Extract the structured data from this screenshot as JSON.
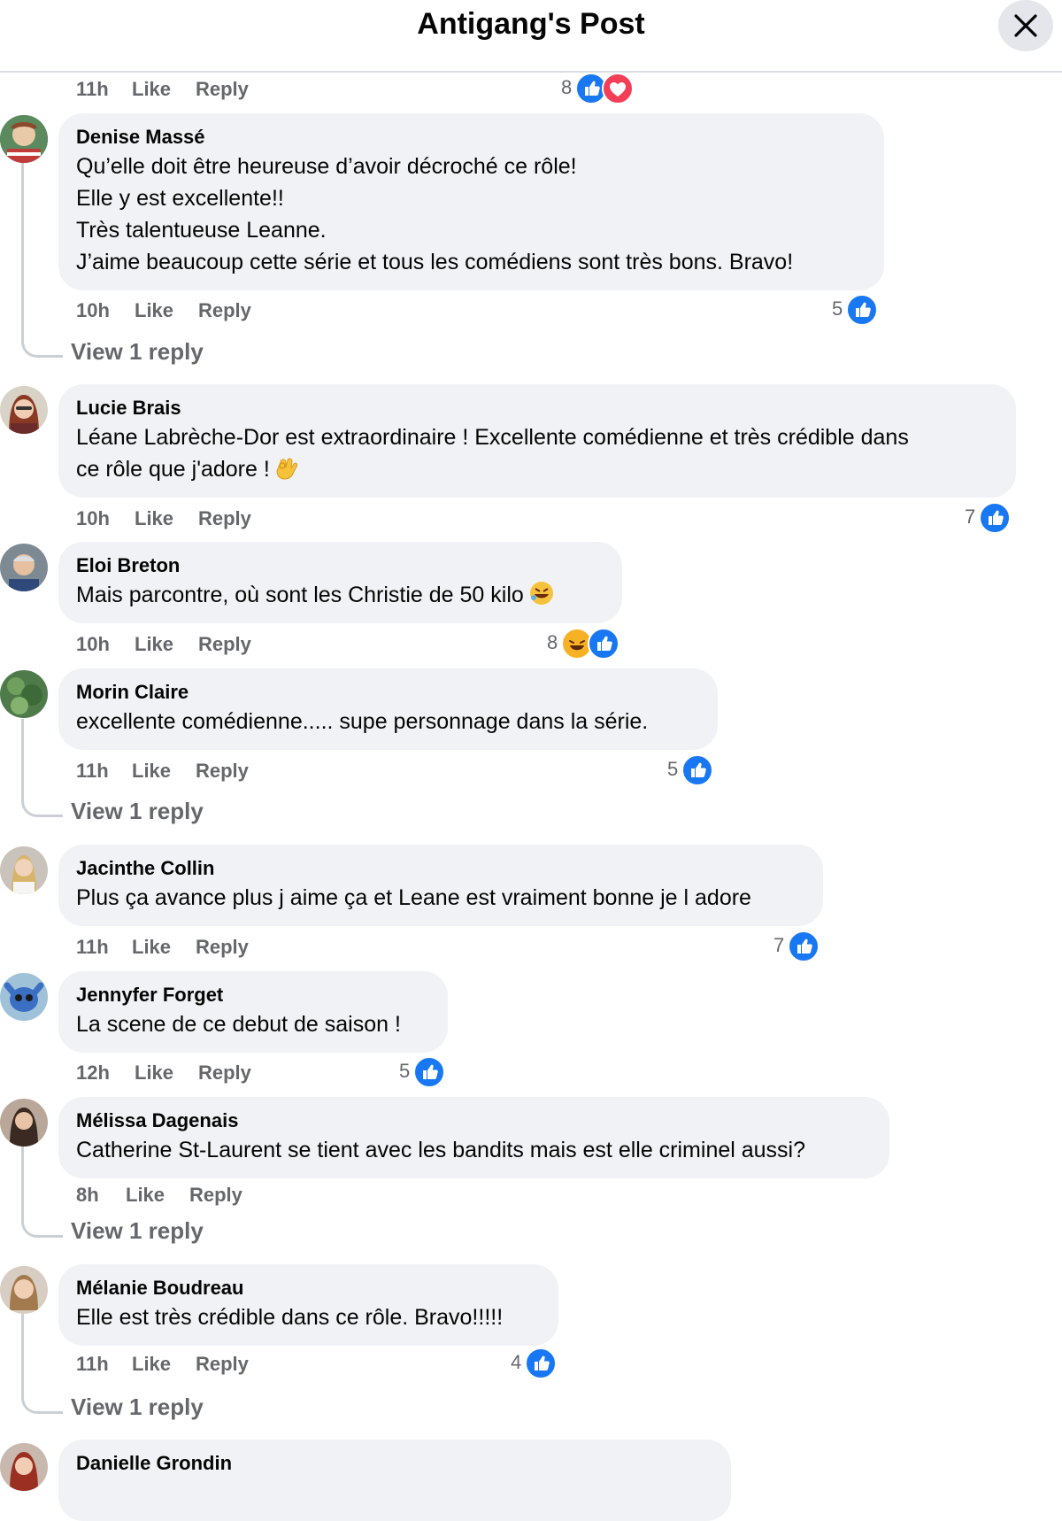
{
  "header": {
    "title": "Antigang's Post"
  },
  "labels": {
    "like": "Like",
    "reply": "Reply"
  },
  "top_meta": {
    "time": "11h",
    "count": "8"
  },
  "comments": [
    {
      "author": "Denise Massé",
      "lines": [
        "Qu’elle doit être heureuse d’avoir décroché ce rôle!",
        "Elle y est excellente!!",
        "Très talentueuse Leanne.",
        "J’aime beaucoup cette série et tous les comédiens sont très bons. Bravo!"
      ],
      "time": "10h",
      "count": "5",
      "view_replies": "View 1 reply"
    },
    {
      "author": "Lucie Brais",
      "lines": [
        "Léane Labrèche-Dor est extraordinaire ! Excellente comédienne et très crédible dans",
        "ce rôle que j'adore !"
      ],
      "time": "10h",
      "count": "7"
    },
    {
      "author": "Eloi Breton",
      "lines": [
        "Mais parcontre, où sont les Christie de 50 kilo"
      ],
      "time": "10h",
      "count": "8"
    },
    {
      "author": "Morin Claire",
      "lines": [
        "excellente comédienne..... supe personnage dans la série."
      ],
      "time": "11h",
      "count": "5",
      "view_replies": "View 1 reply"
    },
    {
      "author": "Jacinthe Collin",
      "lines": [
        "Plus ça avance plus j aime ça et Leane est vraiment bonne je l adore"
      ],
      "time": "11h",
      "count": "7"
    },
    {
      "author": "Jennyfer Forget",
      "lines": [
        "La scene de ce debut de saison !"
      ],
      "time": "12h",
      "count": "5"
    },
    {
      "author": "Mélissa Dagenais",
      "lines": [
        "Catherine St-Laurent se tient avec les bandits mais est elle criminel aussi?"
      ],
      "time": "8h",
      "view_replies": "View 1 reply"
    },
    {
      "author": "Mélanie Boudreau",
      "lines": [
        "Elle est très crédible dans ce rôle. Bravo!!!!!"
      ],
      "time": "11h",
      "count": "4",
      "view_replies": "View 1 reply"
    },
    {
      "author": "Danielle Grondin"
    }
  ]
}
